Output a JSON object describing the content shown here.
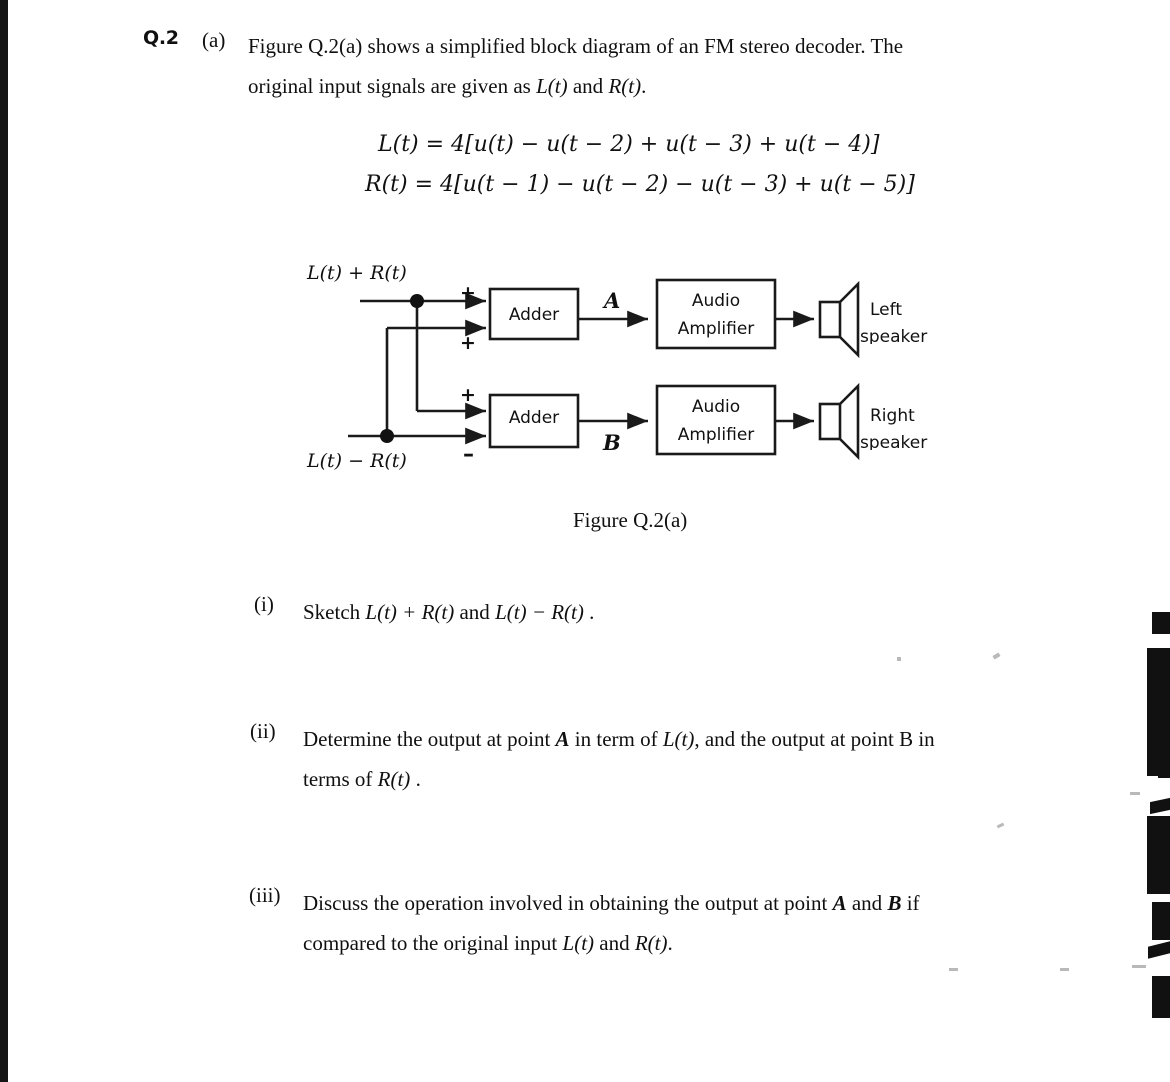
{
  "question": {
    "number": "Q.2",
    "part": "(a)",
    "intro_line1": "Figure Q.2(a) shows a simplified block diagram of an FM stereo decoder. The",
    "intro_line2_pre": "original input signals are given as ",
    "intro_line2_l": "L(t)",
    "intro_line2_mid": " and ",
    "intro_line2_r": "R(t)",
    "intro_line2_end": "."
  },
  "equations": {
    "left": "L(t) = 4[u(t) − u(t − 2) + u(t − 3) + u(t − 4)]",
    "right": "R(t) = 4[u(t − 1) − u(t − 2) − u(t − 3) + u(t − 5)]"
  },
  "diagram": {
    "caption": "Figure Q.2(a)",
    "input_top": "L(t) + R(t)",
    "input_bottom": "L(t) − R(t)",
    "adder_top": "Adder",
    "adder_bottom": "Adder",
    "amp_top_line1": "Audio",
    "amp_top_line2": "Amplifier",
    "amp_bottom_line1": "Audio",
    "amp_bottom_line2": "Amplifier",
    "speaker_top_line1": "Left",
    "speaker_top_line2": "speaker",
    "speaker_bottom_line1": "Right",
    "speaker_bottom_line2": "speaker",
    "point_a": "A",
    "point_b": "B",
    "sign_top_1": "+",
    "sign_top_2": "+",
    "sign_bottom_1": "+",
    "sign_bottom_2": "–"
  },
  "items": {
    "i": {
      "label": "(i)",
      "text_pre": "Sketch ",
      "expr1": "L(t) + R(t)",
      "text_mid": " and ",
      "expr2": "L(t) − R(t)",
      "text_end": " ."
    },
    "ii": {
      "label": "(ii)",
      "line1_a": "Determine the output at point ",
      "line1_a_sym": "A",
      "line1_b": " in term of ",
      "line1_b_sym": "L(t)",
      "line1_c": ", and the output at point B in",
      "line2_a": "terms of ",
      "line2_sym": "R(t)",
      "line2_b": " ."
    },
    "iii": {
      "label": "(iii)",
      "line1_a": "Discuss the operation involved in obtaining the output at point ",
      "line1_sym_a": "A",
      "line1_b": " and ",
      "line1_sym_b": "B",
      "line1_c": " if",
      "line2_a": "compared to the original input ",
      "line2_sym_a": "L(t)",
      "line2_b": " and ",
      "line2_sym_b": "R(t)",
      "line2_c": "."
    }
  },
  "colors": {
    "ink": "#101010",
    "paper": "#ffffff",
    "line": "#1a1a1a"
  }
}
